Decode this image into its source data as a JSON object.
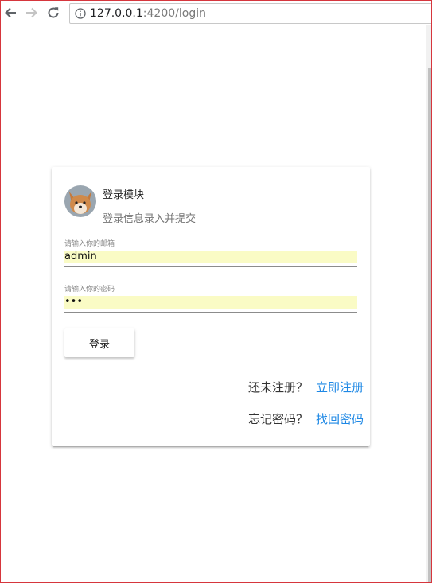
{
  "browser": {
    "url_host": "127.0.0.1",
    "url_path": ":4200/login"
  },
  "icons": {
    "back": "back-arrow-icon",
    "forward": "forward-arrow-icon",
    "reload": "reload-icon",
    "site_info": "info-icon",
    "avatar": "shiba-dog-avatar"
  },
  "colors": {
    "link": "#1e88e5",
    "autofill_background": "#fafbc5",
    "window_border": "#d6363d"
  },
  "login_card": {
    "title": "登录模块",
    "subtitle": "登录信息录入并提交",
    "email_label": "请输入你的邮箱",
    "email_value": "admin",
    "password_label": "请输入你的密码",
    "password_value": "•••",
    "login_button": "登录",
    "register_question": "还未注册？",
    "register_link": "立即注册",
    "forgot_question": "忘记密码？",
    "forgot_link": "找回密码"
  }
}
